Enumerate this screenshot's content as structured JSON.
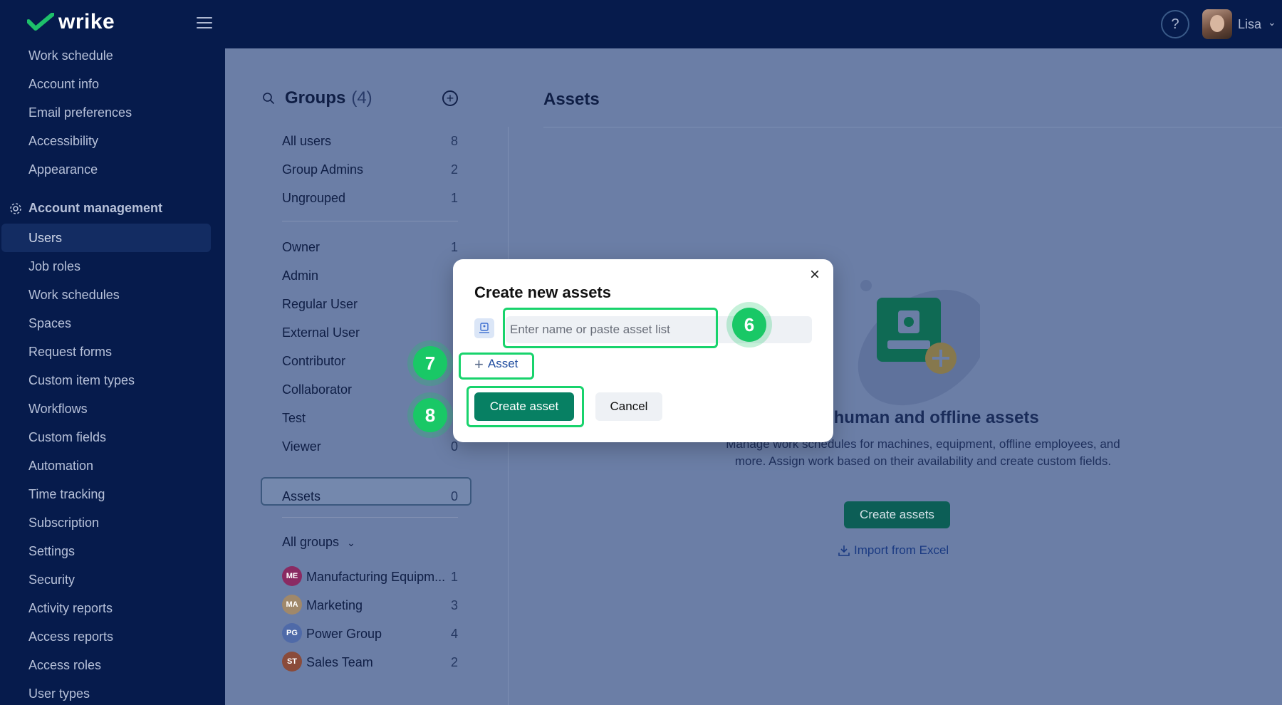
{
  "app": {
    "logo_text": "wrike",
    "user_name": "Lisa"
  },
  "colors": {
    "brand": "#061b4c",
    "accent_green": "#078063",
    "annotation_green": "#18d36c"
  },
  "sidebar": {
    "items_top": [
      "Work schedule",
      "Account info",
      "Email preferences",
      "Accessibility",
      "Appearance"
    ],
    "section_title": "Account management",
    "items": [
      "Users",
      "Job roles",
      "Work schedules",
      "Spaces",
      "Request forms",
      "Custom item types",
      "Workflows",
      "Custom fields",
      "Automation",
      "Time tracking",
      "Subscription",
      "Settings",
      "Security",
      "Activity reports",
      "Access reports",
      "Access roles",
      "User types"
    ],
    "active_item": "Users"
  },
  "groups": {
    "title": "Groups",
    "count": "(4)",
    "builtin": [
      {
        "label": "All users",
        "count": "8"
      },
      {
        "label": "Group Admins",
        "count": "2"
      },
      {
        "label": "Ungrouped",
        "count": "1"
      }
    ],
    "roles": [
      {
        "label": "Owner",
        "count": "1"
      },
      {
        "label": "Admin",
        "count": ""
      },
      {
        "label": "Regular User",
        "count": ""
      },
      {
        "label": "External User",
        "count": ""
      },
      {
        "label": "Contributor",
        "count": ""
      },
      {
        "label": "Collaborator",
        "count": ""
      },
      {
        "label": "Test",
        "count": ""
      },
      {
        "label": "Viewer",
        "count": "0"
      }
    ],
    "assets": {
      "label": "Assets",
      "count": "0"
    },
    "all_groups_label": "All groups",
    "teams": [
      {
        "initials": "ME",
        "name": "Manufacturing Equipm...",
        "count": "1",
        "color": "#8a2a62"
      },
      {
        "initials": "MA",
        "name": "Marketing",
        "count": "3",
        "color": "#a0886a"
      },
      {
        "initials": "PG",
        "name": "Power Group",
        "count": "4",
        "color": "#4f6aa8"
      },
      {
        "initials": "ST",
        "name": "Sales Team",
        "count": "2",
        "color": "#8a4b3a"
      }
    ]
  },
  "assets_panel": {
    "title": "Assets",
    "empty_title": "on-human and offline assets",
    "empty_desc": "Manage work schedules for machines, equipment, offline employees, and more. Assign work based on their availability and create custom fields.",
    "create_button": "Create assets",
    "import_link": "Import from Excel"
  },
  "modal": {
    "title": "Create new assets",
    "input_placeholder": "Enter name or paste asset list",
    "input_value": "",
    "add_link": "Asset",
    "create_button": "Create asset",
    "cancel_button": "Cancel"
  },
  "annotations": {
    "step_6": "6",
    "step_7": "7",
    "step_8": "8"
  }
}
